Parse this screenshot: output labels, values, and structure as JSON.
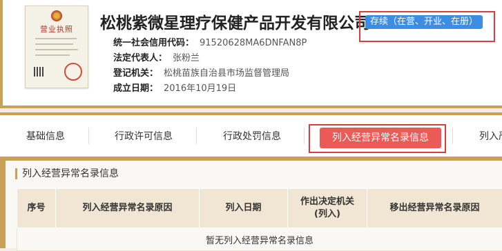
{
  "company": {
    "name": "松桃紫微星理疗保健产品开发有限公司",
    "status": "存续（在营、开业、在册）",
    "license_title": "营业执照"
  },
  "info": [
    {
      "label": "统一社会信用代码：",
      "value": "91520628MA6DNFAN8P"
    },
    {
      "label": "法定代表人：",
      "value": "张粉兰"
    },
    {
      "label": "登记机关：",
      "value": "松桃苗族自治县市场监督管理局"
    },
    {
      "label": "成立日期：",
      "value": "2016年10月19日"
    }
  ],
  "tabs": [
    {
      "label": "基础信息"
    },
    {
      "label": "行政许可信息"
    },
    {
      "label": "行政处罚信息"
    },
    {
      "label": "列入经营异常名录信息"
    },
    {
      "label": "列入严"
    }
  ],
  "panel": {
    "title": "列入经营异常名录信息",
    "columns": [
      "序号",
      "列入经营异常名录原因",
      "列入日期",
      "作出决定机关\n(列入)",
      "移出经营异常名录原因"
    ],
    "empty_text": "暂无列入经营异常名录信息"
  },
  "colors": {
    "accent_gold": "#c8a155",
    "badge_blue": "#3d8ee2",
    "tab_active_red": "#ea5b57",
    "highlight_red": "#e03b3b"
  }
}
